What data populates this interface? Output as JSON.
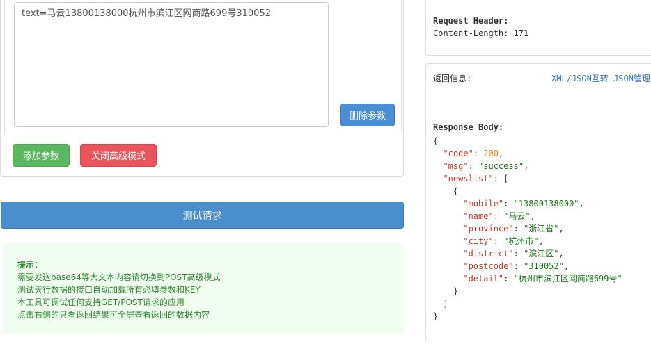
{
  "request": {
    "param_text": "text=马云13800138000杭州市滨江区网商路699号310052",
    "delete_param_label": "删除参数",
    "add_param_label": "添加参数",
    "close_advanced_label": "关闭高级模式",
    "test_request_label": "测试请求"
  },
  "tips": {
    "title": "提示：",
    "lines": [
      "需要发送base64等大文本内容请切换到POST高级模式",
      "测试天行数据的接口自动加载所有必填参数和KEY",
      "本工具可调试任何支持GET/POST请求的应用",
      "点击右侧的只看返回结果可全屏查看返回的数据内容"
    ]
  },
  "request_header": {
    "title": "Request Header:",
    "content_length": "Content-Length: 171"
  },
  "response": {
    "label": "返回信息:",
    "link_xml_json": "XML/JSON互转",
    "link_json_manage": "JSON管理",
    "body_title": "Response Body:",
    "code": 200,
    "msg": "success",
    "newslist": [
      {
        "mobile": "13800138000",
        "name": "马云",
        "province": "浙江省",
        "city": "杭州市",
        "district": "滨江区",
        "postcode": "310052",
        "detail": "杭州市滨江区网商路699号"
      }
    ]
  }
}
